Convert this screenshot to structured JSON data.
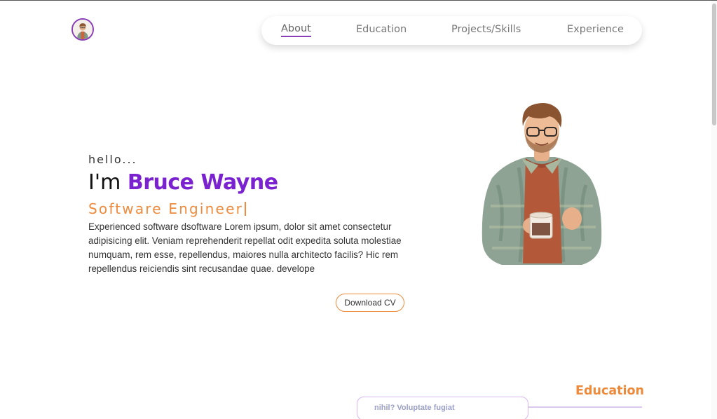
{
  "nav": {
    "items": [
      {
        "label": "About",
        "active": true
      },
      {
        "label": "Education"
      },
      {
        "label": "Projects/Skills"
      },
      {
        "label": "Experience"
      }
    ]
  },
  "hero": {
    "greeting": "hello...",
    "intro_prefix": "I'm ",
    "name": "Bruce Wayne",
    "role": "Software Engineer",
    "description": "Experienced software dsoftware Lorem ipsum, dolor sit amet consectetur adipisicing elit. Veniam reprehenderit repellat odit expedita soluta molestiae numquam, rem esse, repellendus, maiores nulla architecto facilis? Hic rem repellendus reiciendis sint recusandae quae. develope",
    "cv_button": "Download CV"
  },
  "education": {
    "title": "Education",
    "card_text": "nihil? Voluptate fugiat"
  },
  "colors": {
    "accent_purple": "#7a22d0",
    "accent_orange": "#ee8a3c",
    "nav_underline": "#8a3fb8"
  },
  "icons": {
    "logo": "avatar-logo",
    "portrait": "illustrated-man-with-coffee"
  }
}
